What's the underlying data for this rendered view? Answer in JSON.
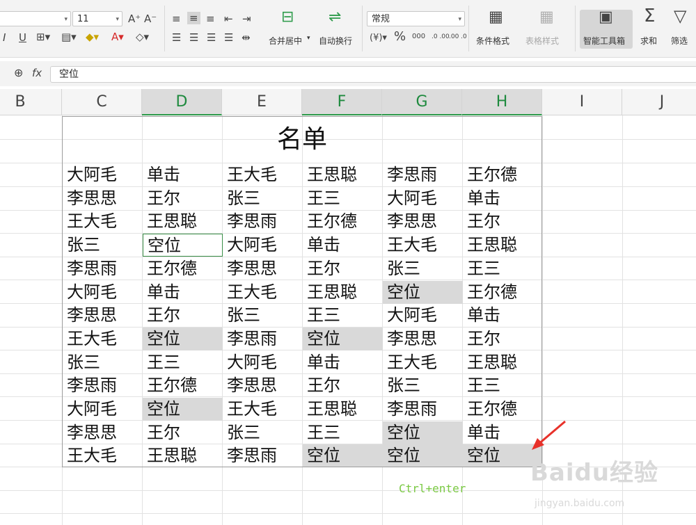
{
  "toolbar": {
    "font_size": "11",
    "number_format": "常规",
    "merge_center": "合并居中",
    "auto_wrap": "自动换行",
    "conditional_format": "条件格式",
    "table_style": "表格样式",
    "smart_toolbox": "智能工具箱",
    "sum": "求和",
    "filter": "筛选",
    "font_inc": "A⁺",
    "font_dec": "A⁻",
    "italic": "I",
    "underline": "U",
    "font_color": "A",
    "percent": "%",
    "thousands": "000",
    "dec_inc": ".0 .00",
    "dec_dec": ".00 .0",
    "currency": "¥"
  },
  "formula_bar": {
    "fx": "fx",
    "value": "空位"
  },
  "columns": [
    "B",
    "C",
    "D",
    "E",
    "F",
    "G",
    "H",
    "I",
    "J"
  ],
  "selected_columns": [
    "D",
    "F",
    "G",
    "H"
  ],
  "sheet": {
    "title": "名单",
    "rows": [
      [
        "大阿毛",
        "单击",
        "王大毛",
        "王思聪",
        "李思雨",
        "王尔德"
      ],
      [
        "李思思",
        "王尔",
        "张三",
        "王三",
        "大阿毛",
        "单击"
      ],
      [
        "王大毛",
        "王思聪",
        "李思雨",
        "王尔德",
        "李思思",
        "王尔"
      ],
      [
        "张三",
        "空位",
        "大阿毛",
        "单击",
        "王大毛",
        "王思聪"
      ],
      [
        "李思雨",
        "王尔德",
        "李思思",
        "王尔",
        "张三",
        "王三"
      ],
      [
        "大阿毛",
        "单击",
        "王大毛",
        "王思聪",
        "空位",
        "王尔德"
      ],
      [
        "李思思",
        "王尔",
        "张三",
        "王三",
        "大阿毛",
        "单击"
      ],
      [
        "王大毛",
        "空位",
        "李思雨",
        "空位",
        "李思思",
        "王尔"
      ],
      [
        "张三",
        "王三",
        "大阿毛",
        "单击",
        "王大毛",
        "王思聪"
      ],
      [
        "李思雨",
        "王尔德",
        "李思思",
        "王尔",
        "张三",
        "王三"
      ],
      [
        "大阿毛",
        "空位",
        "王大毛",
        "王思聪",
        "李思雨",
        "王尔德"
      ],
      [
        "李思思",
        "王尔",
        "张三",
        "王三",
        "空位",
        "单击"
      ],
      [
        "王大毛",
        "王思聪",
        "李思雨",
        "空位",
        "空位",
        "空位"
      ]
    ]
  },
  "annotation": "Ctrl+enter",
  "watermark": {
    "brand": "Baidu经验",
    "url": "jingyan.baidu.com"
  },
  "colors": {
    "accent": "#2e9b4b",
    "highlight": "#d9d9d9",
    "arrow": "#e8312a",
    "note": "#7ac943"
  }
}
